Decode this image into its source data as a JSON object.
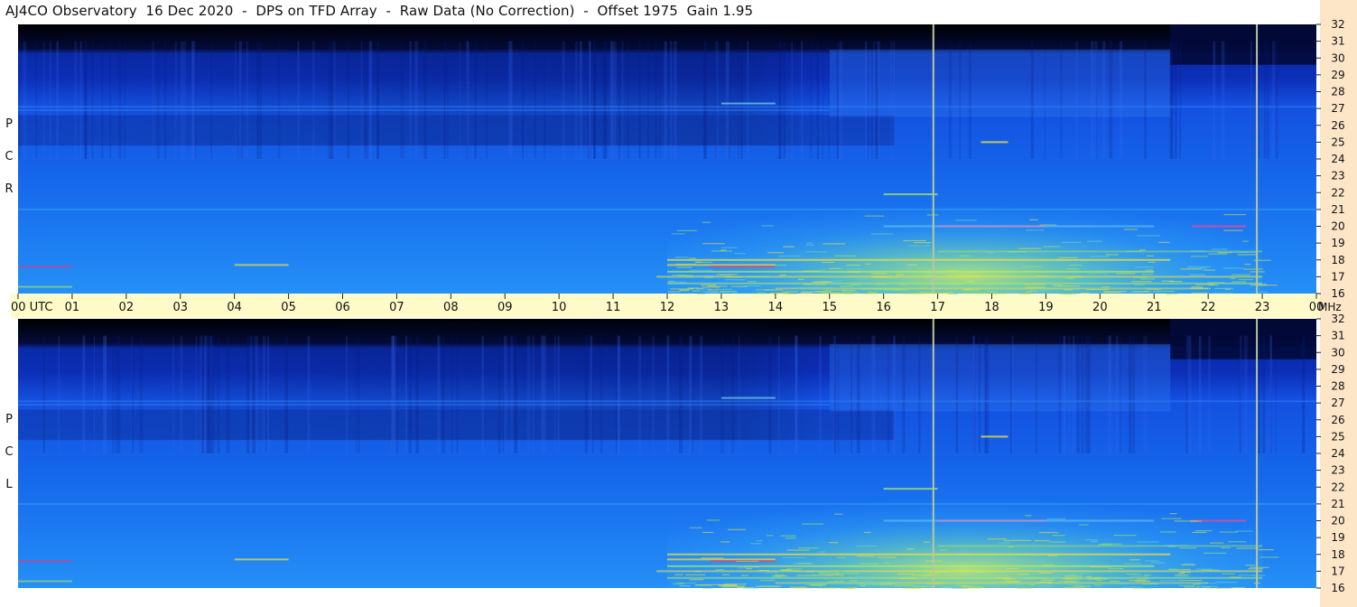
{
  "header": {
    "title": "AJ4CO Observatory  16 Dec 2020  -  DPS on TFD Array  -  Raw Data (No Correction)  -  Offset 1975  Gain 1.95"
  },
  "colors": {
    "background_deep": "#0a1a8a",
    "band_blue": "#1550e0",
    "mid_blue": "#1f7ef0",
    "axis_band": "#fffbc8",
    "right_axis": "#fde5c8",
    "marker_line": "#b8c89a",
    "hot_green": "#a8e858",
    "hot_yellow": "#e8e040",
    "hot_red": "#e84060"
  },
  "chart_data": [
    {
      "type": "heatmap",
      "name": "R C P",
      "x": [
        "00",
        "01",
        "02",
        "03",
        "04",
        "05",
        "06",
        "07",
        "08",
        "09",
        "10",
        "11",
        "12",
        "13",
        "14",
        "15",
        "16",
        "17",
        "18",
        "19",
        "20",
        "21",
        "22",
        "23",
        "00"
      ],
      "x_first_label": "00  UTC",
      "x_last_unit": "MHz",
      "xlim": [
        0,
        24
      ],
      "y_ticks": [
        "16",
        "17",
        "18",
        "19",
        "20",
        "21",
        "22",
        "23",
        "24",
        "25",
        "26",
        "27",
        "28",
        "29",
        "30",
        "31",
        "32"
      ],
      "ylim": [
        16,
        32
      ],
      "markers_utc": [
        16.92,
        22.9
      ],
      "polarization": [
        "R",
        "C",
        "P"
      ]
    },
    {
      "type": "heatmap",
      "name": "L C P",
      "x": [
        "00",
        "01",
        "02",
        "03",
        "04",
        "05",
        "06",
        "07",
        "08",
        "09",
        "10",
        "11",
        "12",
        "13",
        "14",
        "15",
        "16",
        "17",
        "18",
        "19",
        "20",
        "21",
        "22",
        "23",
        "00"
      ],
      "xlim": [
        0,
        24
      ],
      "y_ticks": [
        "16",
        "17",
        "18",
        "19",
        "20",
        "21",
        "22",
        "23",
        "24",
        "25",
        "26",
        "27",
        "28",
        "29",
        "30",
        "31",
        "32"
      ],
      "ylim": [
        16,
        32
      ],
      "markers_utc": [
        16.92,
        22.9
      ],
      "polarization": [
        "L",
        "C",
        "P"
      ]
    }
  ]
}
